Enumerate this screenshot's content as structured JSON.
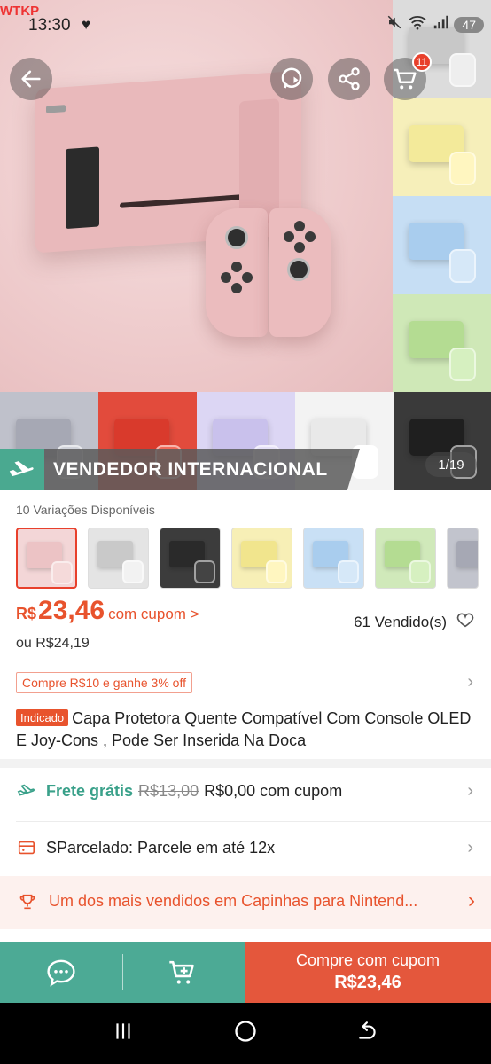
{
  "status_bar": {
    "carrier": "WTKP",
    "time": "13:30",
    "battery": "47"
  },
  "gallery": {
    "counter": "1/19",
    "badge": "VENDEDOR INTERNACIONAL",
    "cart_count": "11",
    "thumb_colors": [
      "#c8c8c8",
      "#f3ea9a",
      "#a9cdee",
      "#b4dc92",
      "#a6a8b4",
      "#d93a2c",
      "#c9c1ec",
      "#e9e9e9",
      "#2a2a2a"
    ]
  },
  "variants": {
    "title": "10 Variações Disponíveis",
    "colors": [
      "#ecc3c5",
      "#c9c9c9",
      "#2a2a2a",
      "#f1e58d",
      "#a9cdee",
      "#b4dc92",
      "#a6a8b4"
    ]
  },
  "price": {
    "currency": "R$",
    "value": "23,46",
    "coupon_link": "com cupom >",
    "alt": "ou R$24,19",
    "sold": "61 Vendido(s)"
  },
  "promo": "Compre R$10 e ganhe 3% off",
  "product": {
    "tag": "Indicado",
    "title": "Capa Protetora Quente Compatível Com Console OLED E Joy-Cons , Pode Ser Inserida Na Doca"
  },
  "shipping": {
    "label": "Frete grátis",
    "old": "R$13,00",
    "new": "R$0,00 com cupom"
  },
  "installments": "SParcelado: Parcele em até 12x",
  "bestseller": "Um dos mais vendidos em Capinhas para Nintend...",
  "buy": {
    "line1": "Compre com cupom",
    "line2": "R$23,46"
  },
  "colors": {
    "accent": "#e8532d",
    "green": "#4caa95"
  }
}
